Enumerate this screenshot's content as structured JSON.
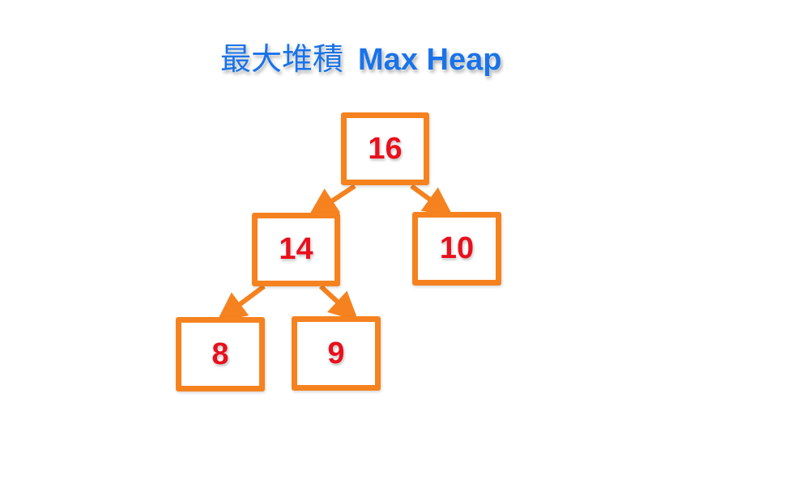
{
  "title": {
    "chinese": "最大堆積",
    "english": "Max Heap"
  },
  "colors": {
    "title": "#1a73e8",
    "node_border": "#f5821f",
    "node_value": "#e8101c",
    "edge": "#f5821f"
  },
  "nodes": [
    {
      "id": "root",
      "value": "16"
    },
    {
      "id": "left",
      "value": "14"
    },
    {
      "id": "right",
      "value": "10"
    },
    {
      "id": "left-left",
      "value": "8"
    },
    {
      "id": "left-right",
      "value": "9"
    }
  ],
  "edges": [
    {
      "from": "root",
      "to": "left"
    },
    {
      "from": "root",
      "to": "right"
    },
    {
      "from": "left",
      "to": "left-left"
    },
    {
      "from": "left",
      "to": "left-right"
    }
  ]
}
